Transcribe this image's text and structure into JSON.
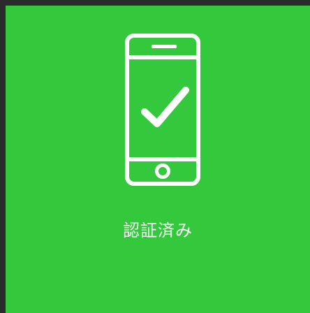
{
  "colors": {
    "card_background": "#34c83d",
    "page_background": "#2a2a2a",
    "icon_color": "#ffffff",
    "text_color": "#ffffff"
  },
  "icon": "smartphone-check-icon",
  "status": {
    "label": "認証済み"
  }
}
